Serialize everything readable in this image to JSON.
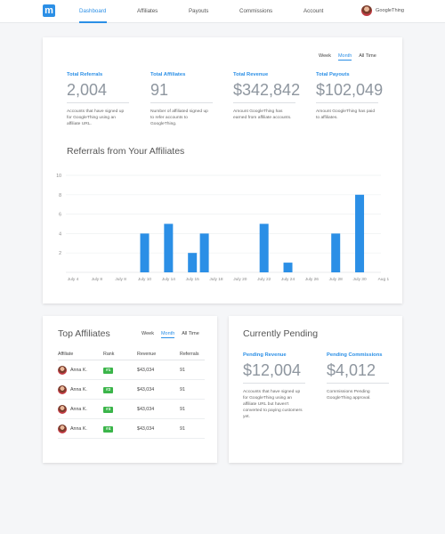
{
  "nav": {
    "logo": "m",
    "items": [
      {
        "label": "Dashboard",
        "active": true
      },
      {
        "label": "Affiliates",
        "active": false
      },
      {
        "label": "Payouts",
        "active": false
      },
      {
        "label": "Commissions",
        "active": false
      },
      {
        "label": "Account",
        "active": false
      }
    ],
    "user_name": "GoogleThing"
  },
  "overview": {
    "period_tabs": [
      {
        "label": "Week",
        "active": false
      },
      {
        "label": "Month",
        "active": true
      },
      {
        "label": "All Time",
        "active": false
      }
    ],
    "stats": [
      {
        "label": "Total Referrals",
        "value": "2,004",
        "desc": "Accounts that have signed up for GoogleThing using an affiliate URL."
      },
      {
        "label": "Total Affiliates",
        "value": "91",
        "desc": "Number of affiliated signed up to refer accounts to GoogleThing."
      },
      {
        "label": "Total Revenue",
        "value": "$342,842",
        "desc": "Amount GoogleThing has earned from affiliate accounts."
      },
      {
        "label": "Total Payouts",
        "value": "$102,049",
        "desc": "Amount GoogleThing has paid to affiliates."
      }
    ],
    "chart_title": "Referrals from Your Affiliates"
  },
  "chart_data": {
    "type": "bar",
    "title": "Referrals from Your Affiliates",
    "xlabel": "",
    "ylabel": "",
    "ylim": [
      0,
      10
    ],
    "yticks": [
      2,
      4,
      6,
      8,
      10
    ],
    "grid": true,
    "color": "#2b8fe6",
    "x_tick_labels": [
      "July 4",
      "July 8",
      "July 8",
      "July 10",
      "July 14",
      "July 15",
      "July 18",
      "July 20",
      "July 22",
      "July 24",
      "July 26",
      "July 28",
      "July 30",
      "Aug 1"
    ],
    "bars": [
      {
        "x": 3.0,
        "value": 4
      },
      {
        "x": 4.0,
        "value": 5
      },
      {
        "x": 5.0,
        "value": 2
      },
      {
        "x": 5.5,
        "value": 4
      },
      {
        "x": 8.0,
        "value": 5
      },
      {
        "x": 9.0,
        "value": 1
      },
      {
        "x": 11.0,
        "value": 4
      },
      {
        "x": 12.0,
        "value": 8
      }
    ]
  },
  "top_affiliates": {
    "title": "Top Affiliates",
    "period_tabs": [
      {
        "label": "Week",
        "active": false
      },
      {
        "label": "Month",
        "active": true
      },
      {
        "label": "All Time",
        "active": false
      }
    ],
    "columns": [
      "Affiliate",
      "Rank",
      "Revenue",
      "Referrals"
    ],
    "rows": [
      {
        "name": "Anna K.",
        "rank": "#1",
        "revenue": "$43,034",
        "referrals": "91"
      },
      {
        "name": "Anna K.",
        "rank": "#2",
        "revenue": "$43,034",
        "referrals": "91"
      },
      {
        "name": "Anna K.",
        "rank": "#3",
        "revenue": "$43,034",
        "referrals": "91"
      },
      {
        "name": "Anna K.",
        "rank": "#4",
        "revenue": "$43,034",
        "referrals": "91"
      }
    ]
  },
  "pending": {
    "title": "Currently Pending",
    "items": [
      {
        "label": "Pending Revenue",
        "value": "$12,004",
        "desc": "Accounts that have signed up for GoogleThing using an affiliate URL but haven't converted to paying customers yet."
      },
      {
        "label": "Pending Commissions",
        "value": "$4,012",
        "desc": "Commissions Pending GoogleThing approval."
      }
    ]
  }
}
